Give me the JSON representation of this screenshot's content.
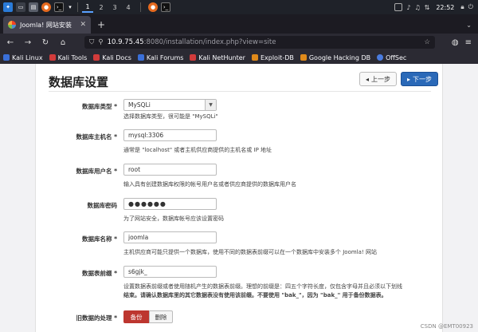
{
  "os_taskbar": {
    "workspaces": [
      "1",
      "2",
      "3",
      "4"
    ],
    "clock": "22:52"
  },
  "browser": {
    "tab_title": "Joomla! 网站安装",
    "url": {
      "host": "10.9.75.45",
      "rest": ":8080/installation/index.php?view=site"
    },
    "bookmarks": [
      {
        "label": "Kali Linux",
        "color": "#3a6fd8"
      },
      {
        "label": "Kali Tools",
        "color": "#d23b3b"
      },
      {
        "label": "Kali Docs",
        "color": "#d23b3b"
      },
      {
        "label": "Kali Forums",
        "color": "#3a6fd8"
      },
      {
        "label": "Kali NetHunter",
        "color": "#d23b3b"
      },
      {
        "label": "Exploit-DB",
        "color": "#e08a1a"
      },
      {
        "label": "Google Hacking DB",
        "color": "#e08a1a"
      },
      {
        "label": "OffSec",
        "color": "#4a7ce0"
      }
    ]
  },
  "page": {
    "title": "数据库设置",
    "prev_label": "上一步",
    "next_label": "下一步",
    "fields": {
      "db_type": {
        "label": "数据库类型 *",
        "value": "MySQLi",
        "help": "选择数据库类型，很可能是 \"MySQLi\""
      },
      "db_host": {
        "label": "数据库主机名 *",
        "value": "mysql:3306",
        "help": "通常是 \"localhost\" 或者主机供应商提供的主机名或 IP 地址"
      },
      "db_user": {
        "label": "数据库用户名 *",
        "value": "root",
        "help": "输入具有创建数据库权限的帐号用户名或者供应商提供的数据库用户名"
      },
      "db_password": {
        "label": "数据库密码",
        "value": "●●●●●●",
        "help": "为了网站安全，数据库帐号应该设置密码"
      },
      "db_name": {
        "label": "数据库名称 *",
        "value": "joomla",
        "help": "主机供应商可能只提供一个数据库，使用不同的数据表前缀可以在一个数据库中安装多个 Joomla! 网站"
      },
      "db_prefix": {
        "label": "数据表前缀 *",
        "value": "s6gjk_",
        "help_line1": "设置数据表前缀或者使用随机产生的数据表前缀。理想的前缀是：四五个字符长度，仅包含字母并且必须以下划线",
        "help_line2": "结束。请确认数据库里的其它数据表没有使用该前缀。不要使用 \"bak_\"，因为 \"bak_\" 用于备份数据表。"
      },
      "old_data": {
        "label": "旧数据的处理 *",
        "backup_label": "备份",
        "delete_label": "删除"
      }
    }
  },
  "watermark": "CSDN @EMT00923"
}
